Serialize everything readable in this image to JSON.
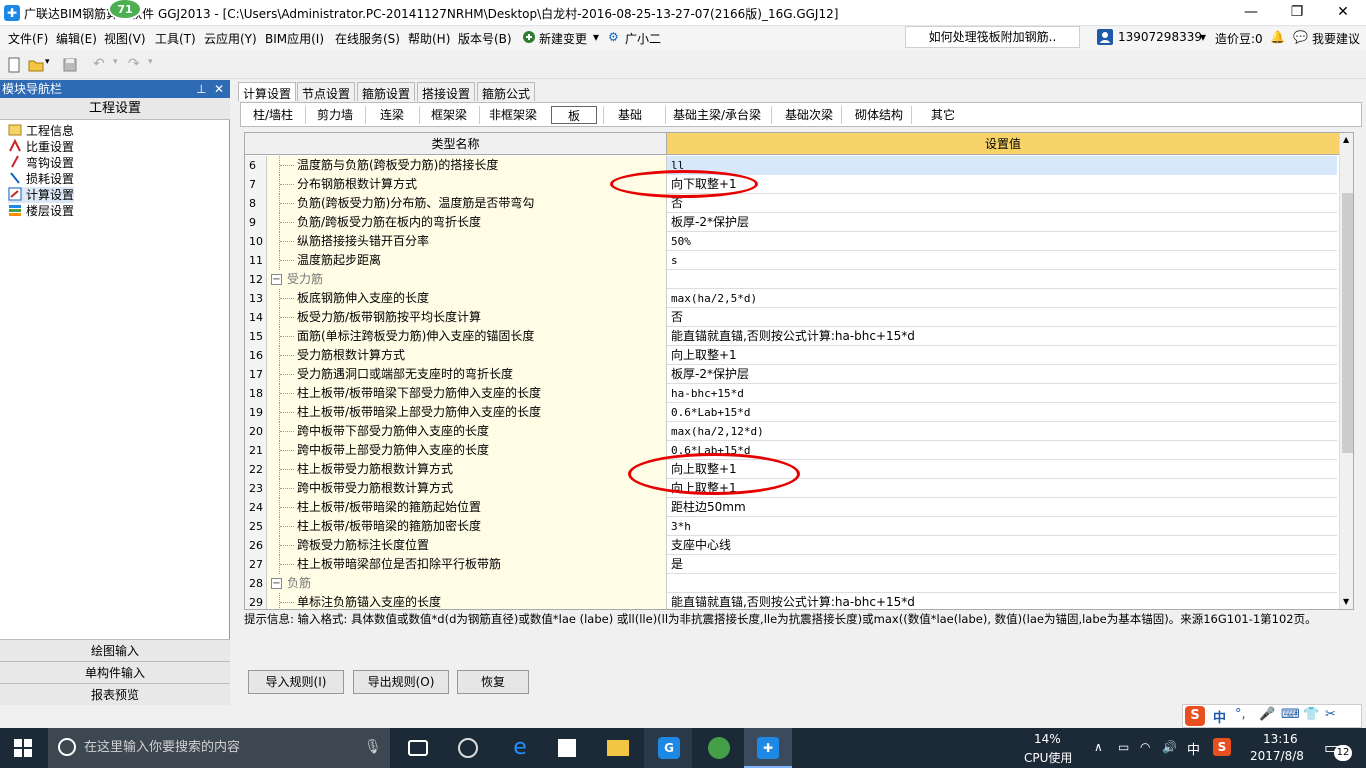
{
  "window": {
    "title": "广联达BIM钢筋算量软件 GGJ2013 - [C:\\Users\\Administrator.PC-20141127NRHM\\Desktop\\白龙村-2016-08-25-13-27-07(2166版)_16G.GGJ12]",
    "badge": "71",
    "minimize": "—",
    "maximize": "❐",
    "close": "✕"
  },
  "menu": {
    "items": [
      "文件(F)",
      "编辑(E)",
      "视图(V)",
      "工具(T)",
      "云应用(Y)",
      "BIM应用(I)",
      "在线服务(S)",
      "帮助(H)",
      "版本号(B)",
      "新建变更",
      "广小二"
    ],
    "help_tip": "如何处理筏板附加钢筋..",
    "phone": "13907298339",
    "coins": "造价豆:0",
    "suggest": "我要建议"
  },
  "nav": {
    "header": "模块导航栏",
    "pin": "ᵖ",
    "close": "✕",
    "section": "工程设置",
    "items": [
      "工程信息",
      "比重设置",
      "弯钩设置",
      "损耗设置",
      "计算设置",
      "楼层设置"
    ],
    "bottom": [
      "绘图输入",
      "单构件输入",
      "报表预览"
    ]
  },
  "tabs1": [
    "计算设置",
    "节点设置",
    "箍筋设置",
    "搭接设置",
    "箍筋公式"
  ],
  "tabs2": [
    "柱/墙柱",
    "剪力墙",
    "连梁",
    "框架梁",
    "非框架梁",
    "板",
    "基础",
    "基础主梁/承台梁",
    "基础次梁",
    "砌体结构",
    "其它"
  ],
  "grid": {
    "col_name": "类型名称",
    "col_value": "设置值",
    "rows": [
      {
        "n": "6",
        "name": "温度筋与负筋(跨板受力筋)的搭接长度",
        "value": "ll",
        "group": false
      },
      {
        "n": "7",
        "name": "分布钢筋根数计算方式",
        "value": "向下取整+1",
        "group": false
      },
      {
        "n": "8",
        "name": "负筋(跨板受力筋)分布筋、温度筋是否带弯勾",
        "value": "否",
        "group": false
      },
      {
        "n": "9",
        "name": "负筋/跨板受力筋在板内的弯折长度",
        "value": "板厚-2*保护层",
        "group": false
      },
      {
        "n": "10",
        "name": "纵筋搭接接头错开百分率",
        "value": "50%",
        "group": false
      },
      {
        "n": "11",
        "name": "温度筋起步距离",
        "value": "s",
        "group": false
      },
      {
        "n": "12",
        "name": "受力筋",
        "value": "",
        "group": true
      },
      {
        "n": "13",
        "name": "板底钢筋伸入支座的长度",
        "value": "max(ha/2,5*d)",
        "group": false
      },
      {
        "n": "14",
        "name": "板受力筋/板带钢筋按平均长度计算",
        "value": "否",
        "group": false
      },
      {
        "n": "15",
        "name": "面筋(单标注跨板受力筋)伸入支座的锚固长度",
        "value": "能直锚就直锚,否则按公式计算:ha-bhc+15*d",
        "group": false
      },
      {
        "n": "16",
        "name": "受力筋根数计算方式",
        "value": "向上取整+1",
        "group": false
      },
      {
        "n": "17",
        "name": "受力筋遇洞口或端部无支座时的弯折长度",
        "value": "板厚-2*保护层",
        "group": false
      },
      {
        "n": "18",
        "name": "柱上板带/板带暗梁下部受力筋伸入支座的长度",
        "value": "ha-bhc+15*d",
        "group": false
      },
      {
        "n": "19",
        "name": "柱上板带/板带暗梁上部受力筋伸入支座的长度",
        "value": "0.6*Lab+15*d",
        "group": false
      },
      {
        "n": "20",
        "name": "跨中板带下部受力筋伸入支座的长度",
        "value": "max(ha/2,12*d)",
        "group": false
      },
      {
        "n": "21",
        "name": "跨中板带上部受力筋伸入支座的长度",
        "value": "0.6*Lab+15*d",
        "group": false
      },
      {
        "n": "22",
        "name": "柱上板带受力筋根数计算方式",
        "value": "向上取整+1",
        "group": false
      },
      {
        "n": "23",
        "name": "跨中板带受力筋根数计算方式",
        "value": "向上取整+1",
        "group": false
      },
      {
        "n": "24",
        "name": "柱上板带/板带暗梁的箍筋起始位置",
        "value": "距柱边50mm",
        "group": false
      },
      {
        "n": "25",
        "name": "柱上板带/板带暗梁的箍筋加密长度",
        "value": "3*h",
        "group": false
      },
      {
        "n": "26",
        "name": "跨板受力筋标注长度位置",
        "value": "支座中心线",
        "group": false
      },
      {
        "n": "27",
        "name": "柱上板带暗梁部位是否扣除平行板带筋",
        "value": "是",
        "group": false
      },
      {
        "n": "28",
        "name": "负筋",
        "value": "",
        "group": true
      },
      {
        "n": "29",
        "name": "单标注负筋锚入支座的长度",
        "value": "能直锚就直锚,否则按公式计算:ha-bhc+15*d",
        "group": false
      }
    ]
  },
  "hint": "提示信息: 输入格式: 具体数值或数值*d(d为钢筋直径)或数值*lae (labe) 或ll(lle)(ll为非抗震搭接长度,lle为抗震搭接长度)或max((数值*lae(labe), 数值)(lae为锚固,labe为基本锚固)。来源16G101-1第102页。",
  "buttons": {
    "import": "导入规则(I)",
    "export": "导出规则(O)",
    "restore": "恢复"
  },
  "taskbar": {
    "search_placeholder": "在这里输入你要搜索的内容",
    "cpu_pct": "14%",
    "cpu_label": "CPU使用",
    "ime_lang": "中",
    "time": "13:16",
    "date": "2017/8/8",
    "notif_count": "12"
  },
  "ime_bar": {
    "mode": "中"
  },
  "colors": {
    "accent": "#2f6bb5",
    "header_bg": "#f7d36a",
    "name_bg": "#fffde6",
    "annotation": "#e60000"
  }
}
